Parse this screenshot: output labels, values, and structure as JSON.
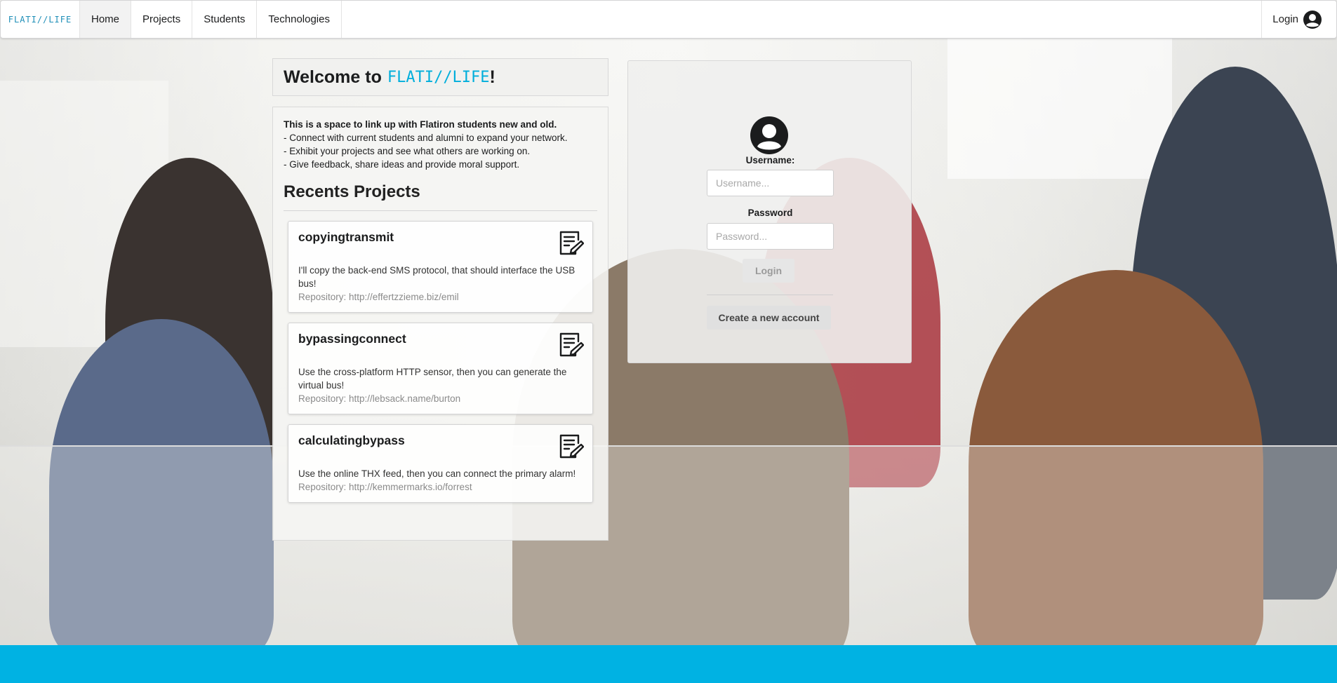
{
  "nav": {
    "logo": "FLATI//LIFE",
    "items": [
      {
        "label": "Home"
      },
      {
        "label": "Projects"
      },
      {
        "label": "Students"
      },
      {
        "label": "Technologies"
      }
    ],
    "login_label": "Login",
    "active_item": "Home"
  },
  "welcome": {
    "prefix": "Welcome to",
    "brand": "FLATI//LIFE",
    "suffix": "!"
  },
  "intro": {
    "headline": "This is a space to link up with Flatiron students new and old.",
    "bullets": [
      "- Connect with current students and alumni to expand your network.",
      "- Exhibit your projects and see what others are working on.",
      "- Give feedback, share ideas and provide moral support."
    ]
  },
  "recent": {
    "title": "Recents Projects",
    "projects": [
      {
        "name": "copyingtransmit",
        "description": "I'll copy the back-end SMS protocol, that should interface the USB bus!",
        "repo": "Repository: http://effertzzieme.biz/emil"
      },
      {
        "name": "bypassingconnect",
        "description": "Use the cross-platform HTTP sensor, then you can generate the virtual bus!",
        "repo": "Repository: http://lebsack.name/burton"
      },
      {
        "name": "calculatingbypass",
        "description": "Use the online THX feed, then you can connect the primary alarm!",
        "repo": "Repository: http://kemmermarks.io/forrest"
      }
    ],
    "project_icon": "edit-note-icon"
  },
  "login": {
    "username_label": "Username:",
    "username_placeholder": "Username...",
    "username_value": "",
    "password_label": "Password",
    "password_placeholder": "Password...",
    "password_value": "",
    "login_button": "Login",
    "create_button": "Create a new account",
    "avatar_icon": "user-circle-icon"
  },
  "colors": {
    "brand": "#00aedb",
    "footer": "#00b2e3",
    "logo": "#1f8fb8"
  }
}
